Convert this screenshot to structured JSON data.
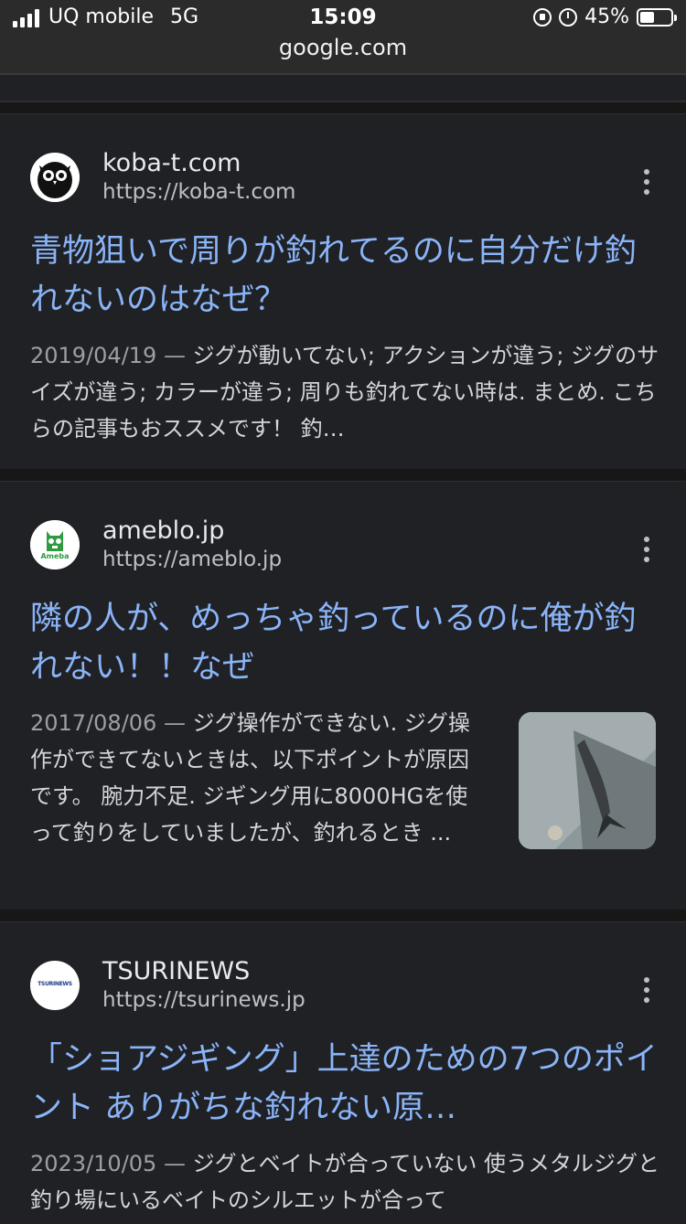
{
  "status": {
    "carrier": "UQ mobile",
    "network": "5G",
    "time": "15:09",
    "battery": "45%",
    "url": "google.com"
  },
  "results": [
    {
      "site_name": "koba-t.com",
      "site_url": "https://koba-t.com",
      "title": "青物狙いで周りが釣れてるのに自分だけ釣れないのはなぜ？",
      "date": "2019/04/19 —",
      "snippet": "ジグが動いてない; アクションが違う; ジグのサイズが違う; カラーが違う; 周りも釣れてない時は. まとめ. こちらの記事もおススメです！ 釣…"
    },
    {
      "site_name": "ameblo.jp",
      "site_url": "https://ameblo.jp",
      "favicon_text": "Ameba",
      "title": "隣の人が、めっちゃ釣っているのに俺が釣れない！！なぜ",
      "date": "2017/08/06 —",
      "snippet": "ジグ操作ができない. ジグ操作ができてないときは、以下ポイントが原因です。 腕力不足. ジギング用に8000HGを使って釣りをしていましたが、釣れるとき ..."
    },
    {
      "site_name": "TSURINEWS",
      "site_url": "https://tsurinews.jp",
      "favicon_text": "TSURINEWS",
      "title": "「ショアジギング」上達のための7つのポイント ありがちな釣れない原…",
      "date": "2023/10/05 —",
      "snippet": "ジグとベイトが合っていない 使うメタルジグと釣り場にいるベイトのシルエットが合って"
    }
  ]
}
